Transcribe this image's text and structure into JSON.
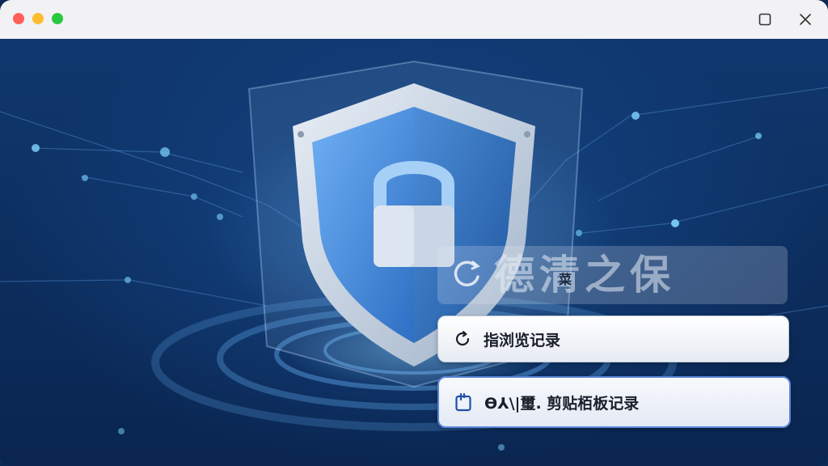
{
  "window": {
    "controls": {
      "close_dot": "close-dot",
      "minimize_dot": "minimize-dot",
      "zoom_dot": "zoom-dot",
      "maximize_icon": "square-icon",
      "close_icon": "x-icon"
    }
  },
  "brand": {
    "icon": "shield-refresh-icon",
    "title": "德清之保",
    "subtitle": "菜"
  },
  "actions": {
    "history": {
      "icon": "refresh-icon",
      "label": "指浏览记录"
    },
    "clipboard": {
      "icon": "clipboard-icon",
      "label": "Ѳ⅄\\|璽. 剪贴栢板记录"
    }
  },
  "colors": {
    "accent": "#5b84d6",
    "background": "#0d2f61",
    "shield": "#4a8fe0"
  }
}
